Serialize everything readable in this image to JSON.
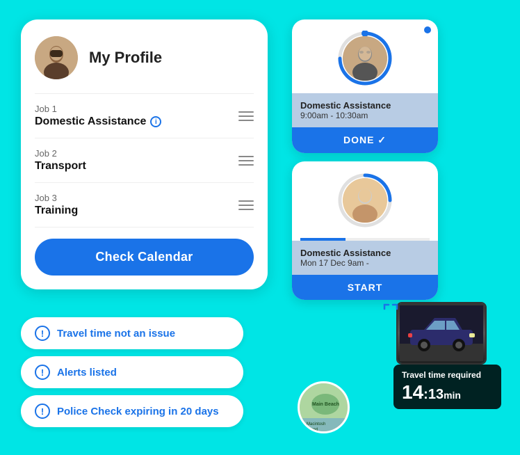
{
  "background_color": "#00e5e5",
  "left_card": {
    "profile_title": "My Profile",
    "jobs": [
      {
        "label": "Job 1",
        "title": "Domestic Assistance",
        "has_info": true
      },
      {
        "label": "Job 2",
        "title": "Transport",
        "has_info": false
      },
      {
        "label": "Job 3",
        "title": "Training",
        "has_info": false
      }
    ],
    "calendar_button": "Check Calendar"
  },
  "notifications": [
    {
      "text": "Travel time not an issue"
    },
    {
      "text": "Alerts listed"
    },
    {
      "text": "Police Check expiring in 20 days"
    }
  ],
  "right_cards": [
    {
      "job_title": "Domestic Assistance",
      "time": "9:00am - 10:30am",
      "action": "DONE",
      "status": "done"
    },
    {
      "job_title": "Domestic Assistance",
      "date": "Mon 17 Dec",
      "time": "9am -",
      "action": "START",
      "status": "start"
    }
  ],
  "travel_info": {
    "title": "Travel time required",
    "value": "14 13 m n"
  },
  "map_labels": {
    "area1": "Main Beach",
    "area2": "Macintosh Island"
  }
}
